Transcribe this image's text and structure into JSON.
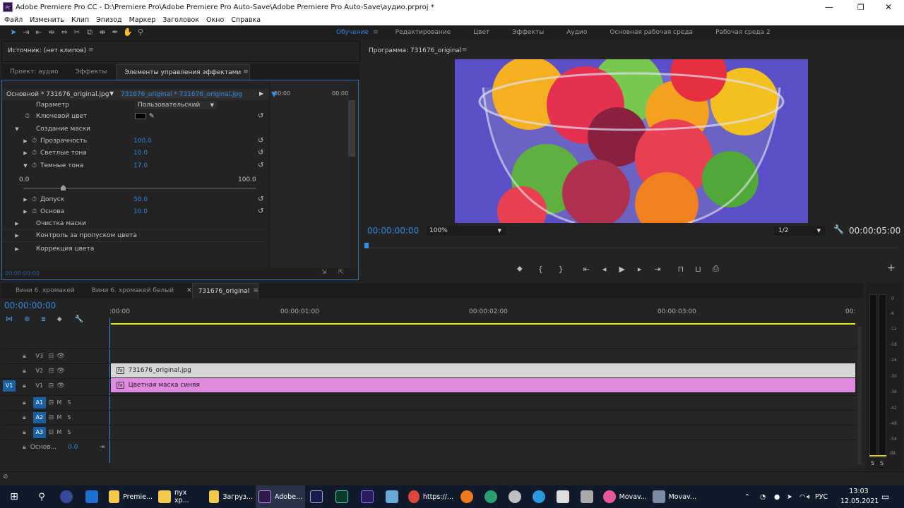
{
  "window": {
    "title": "Adobe Premiere Pro CC - D:\\Premiere Pro\\Adobe Premiere Pro Auto-Save\\Adobe Premiere Pro Auto-Save\\аудио.prproj *"
  },
  "menu": [
    "Файл",
    "Изменить",
    "Клип",
    "Эпизод",
    "Маркер",
    "Заголовок",
    "Окно",
    "Справка"
  ],
  "workspaces": {
    "active": "Обучение",
    "items": [
      "Редактирование",
      "Цвет",
      "Эффекты",
      "Аудио",
      "Основная рабочая среда",
      "Рабочая среда 2"
    ]
  },
  "source": {
    "title": "Источник: (нет клипов)"
  },
  "left_tabs": [
    "Проект: аудио",
    "Эффекты",
    "Элементы управления эффектами"
  ],
  "effect_controls": {
    "clip_master": "Основной * 731676_original.jpg",
    "clip_seq": "731676_original * 731676_original.jpg",
    "tc_start": "00:00",
    "tc_end": "00:00",
    "param_label": "Параметр",
    "param_value": "Пользовательский",
    "key_color_label": "Ключевой цвет",
    "section_mask": "Создание маски",
    "transparency": {
      "label": "Прозрачность",
      "value": "100.0"
    },
    "highlights": {
      "label": "Светлые тона",
      "value": "10.0"
    },
    "shadows": {
      "label": "Темные тона",
      "value": "17.0"
    },
    "slider": {
      "min": "0.0",
      "max": "100.0",
      "level": 0.17
    },
    "tolerance": {
      "label": "Допуск",
      "value": "50.0"
    },
    "base": {
      "label": "Основа",
      "value": "10.0"
    },
    "mask_cleanup": "Очистка маски",
    "spill": "Контроль за пропуском цвета",
    "color_correction": "Коррекция цвета",
    "bottom_tc": "00:00:00:00"
  },
  "program": {
    "title": "Программа: 731676_original",
    "timecode": "00:00:00:00",
    "zoom": "100%",
    "resolution": "1/2",
    "duration": "00:00:05:00"
  },
  "timeline": {
    "tabs": [
      "Вини 6. хромакей",
      "Вини 6. хромакей белый",
      "731676_original"
    ],
    "timecode": "00:00:00:00",
    "ruler": [
      ":00:00",
      "00:00:01:00",
      "00:00:02:00",
      "00:00:03:00",
      "00:"
    ],
    "video_tracks": [
      "V3",
      "V2",
      "V1"
    ],
    "audio_tracks": [
      "A1",
      "A2",
      "A3"
    ],
    "source_patch": "V1",
    "master_label": "Основ...",
    "master_value": "0.0",
    "clip_v2": "731676_original.jpg",
    "clip_v1": "Цветная маска синяя",
    "m_label": "M",
    "s_label": "S"
  },
  "vu": {
    "ticks": [
      "0",
      "-6",
      "-12",
      "-18",
      "-24",
      "-30",
      "-36",
      "-42",
      "-48",
      "-54",
      "dB"
    ],
    "bottom": [
      "S",
      "S"
    ]
  },
  "taskbar": {
    "items": [
      "Premie...",
      "пух хр...",
      "Загруз...",
      "Adobe...",
      "https://...",
      "Movav...",
      "Movav..."
    ],
    "lang": "РУС",
    "time": "13:03",
    "date": "12.05.2021"
  },
  "colors": {
    "accent": "#2e86de",
    "clip_v2": "#d6d6d6",
    "clip_v1": "#e08ae0",
    "playhead": "#3a8be0",
    "work_bar": "#e6e61e"
  }
}
